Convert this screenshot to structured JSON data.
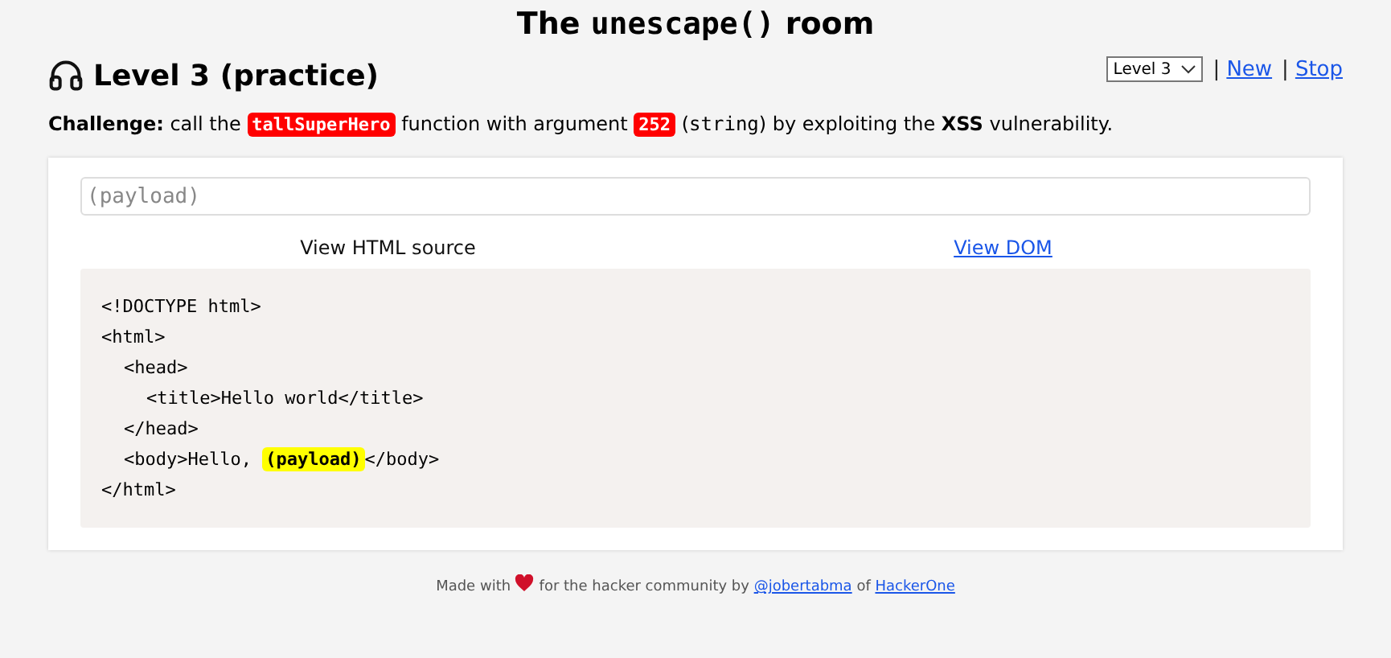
{
  "page_title": [
    {
      "text": "The "
    },
    {
      "text": "unescape()",
      "kind": "code"
    },
    {
      "text": " room"
    }
  ],
  "level_title": "Level 3 (practice)",
  "level_select": {
    "value": "Level 3"
  },
  "nav_links": [
    {
      "separator": "|",
      "label": "New"
    },
    {
      "separator": "|",
      "label": "Stop"
    }
  ],
  "challenge": [
    {
      "text": "Challenge:",
      "kind": "bold"
    },
    {
      "text": " call the "
    },
    {
      "text": "tallSuperHero",
      "kind": "badge"
    },
    {
      "text": " function with argument "
    },
    {
      "text": "252",
      "kind": "badge"
    },
    {
      "text": " ("
    },
    {
      "text": "string",
      "kind": "code"
    },
    {
      "text": ") by exploiting the "
    },
    {
      "text": "XSS",
      "kind": "bold"
    },
    {
      "text": " vulnerability."
    }
  ],
  "payload_field": {
    "placeholder": "(payload)"
  },
  "views": [
    {
      "label": "View HTML source",
      "selected": true
    },
    {
      "label": "View DOM",
      "selected": false
    }
  ],
  "source": [
    {
      "parts": [
        {
          "text": "<!DOCTYPE html>"
        }
      ]
    },
    {
      "parts": [
        {
          "text": "<html>"
        }
      ],
      "children": [
        {
          "parts": [
            {
              "text": "<head>"
            }
          ],
          "children": [
            {
              "parts": [
                {
                  "text": "<title>Hello world</title>"
                }
              ]
            }
          ]
        },
        {
          "parts": [
            {
              "text": "</head>"
            }
          ]
        },
        {
          "parts": [
            {
              "text": "<body>Hello, "
            },
            {
              "text": "(payload)",
              "kind": "highlight"
            },
            {
              "text": "</body>"
            }
          ]
        }
      ]
    },
    {
      "parts": [
        {
          "text": "</html>"
        }
      ]
    }
  ],
  "footer": [
    {
      "text": "Made with "
    },
    {
      "kind": "heart"
    },
    {
      "text": " for the hacker community by "
    },
    {
      "text": "@jobertabma",
      "kind": "link"
    },
    {
      "text": " of "
    },
    {
      "text": "HackerOne",
      "kind": "link"
    }
  ]
}
